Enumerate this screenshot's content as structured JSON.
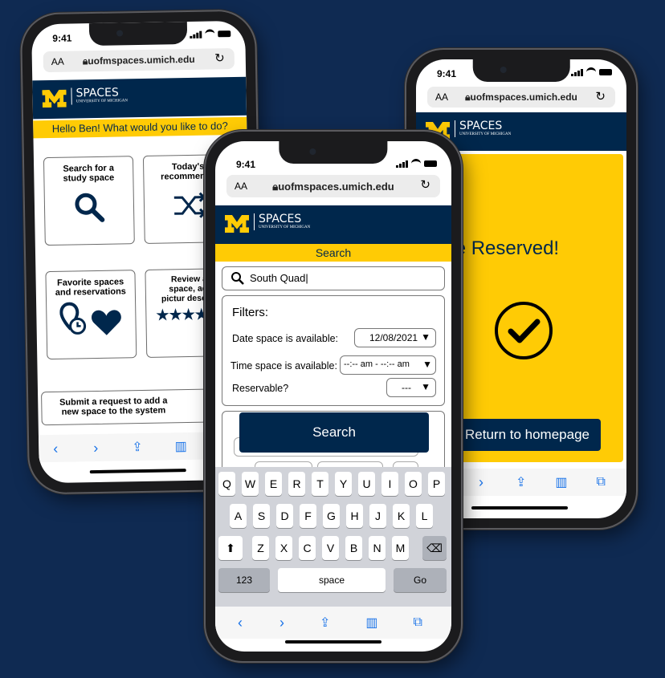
{
  "status_time": "9:41",
  "url": "uofmspaces.umich.edu",
  "url_text_size": "AA",
  "brand": {
    "name": "SPACES",
    "subtitle": "UNIVERSITY OF MICHIGAN"
  },
  "left_phone": {
    "greeting": "Hello Ben! What would you like to do?",
    "cards": {
      "search": "Search for a study space",
      "recommend": "Today's recommenda",
      "favorites": "Favorite spaces and reservations",
      "review": "Review a st space, add a pictur descriptio"
    },
    "submit_request": "Submit a request to add a new space to the system"
  },
  "middle_phone": {
    "title": "Search",
    "search_value": "South Quad|",
    "filters_heading": "Filters:",
    "date_label": "Date space is available:",
    "date_value": "12/08/2021",
    "time_label": "Time space is available:",
    "time_value": "--:-- am - --:-- am",
    "reservable_label": "Reservable?",
    "reservable_value": "---",
    "search_button": "Search",
    "keyboard": {
      "row1": [
        "Q",
        "W",
        "E",
        "R",
        "T",
        "Y",
        "U",
        "I",
        "O",
        "P"
      ],
      "row2": [
        "A",
        "S",
        "D",
        "F",
        "G",
        "H",
        "J",
        "K",
        "L"
      ],
      "row3": [
        "Z",
        "X",
        "C",
        "V",
        "B",
        "N",
        "M"
      ],
      "numbers_key": "123",
      "space_key": "space",
      "go_key": "Go"
    }
  },
  "right_phone": {
    "confirmation": "pace Reserved!",
    "return_button": "Return to homepage"
  },
  "colors": {
    "background": "#0f2a52",
    "maize": "#ffcb05",
    "blue": "#00274c"
  }
}
